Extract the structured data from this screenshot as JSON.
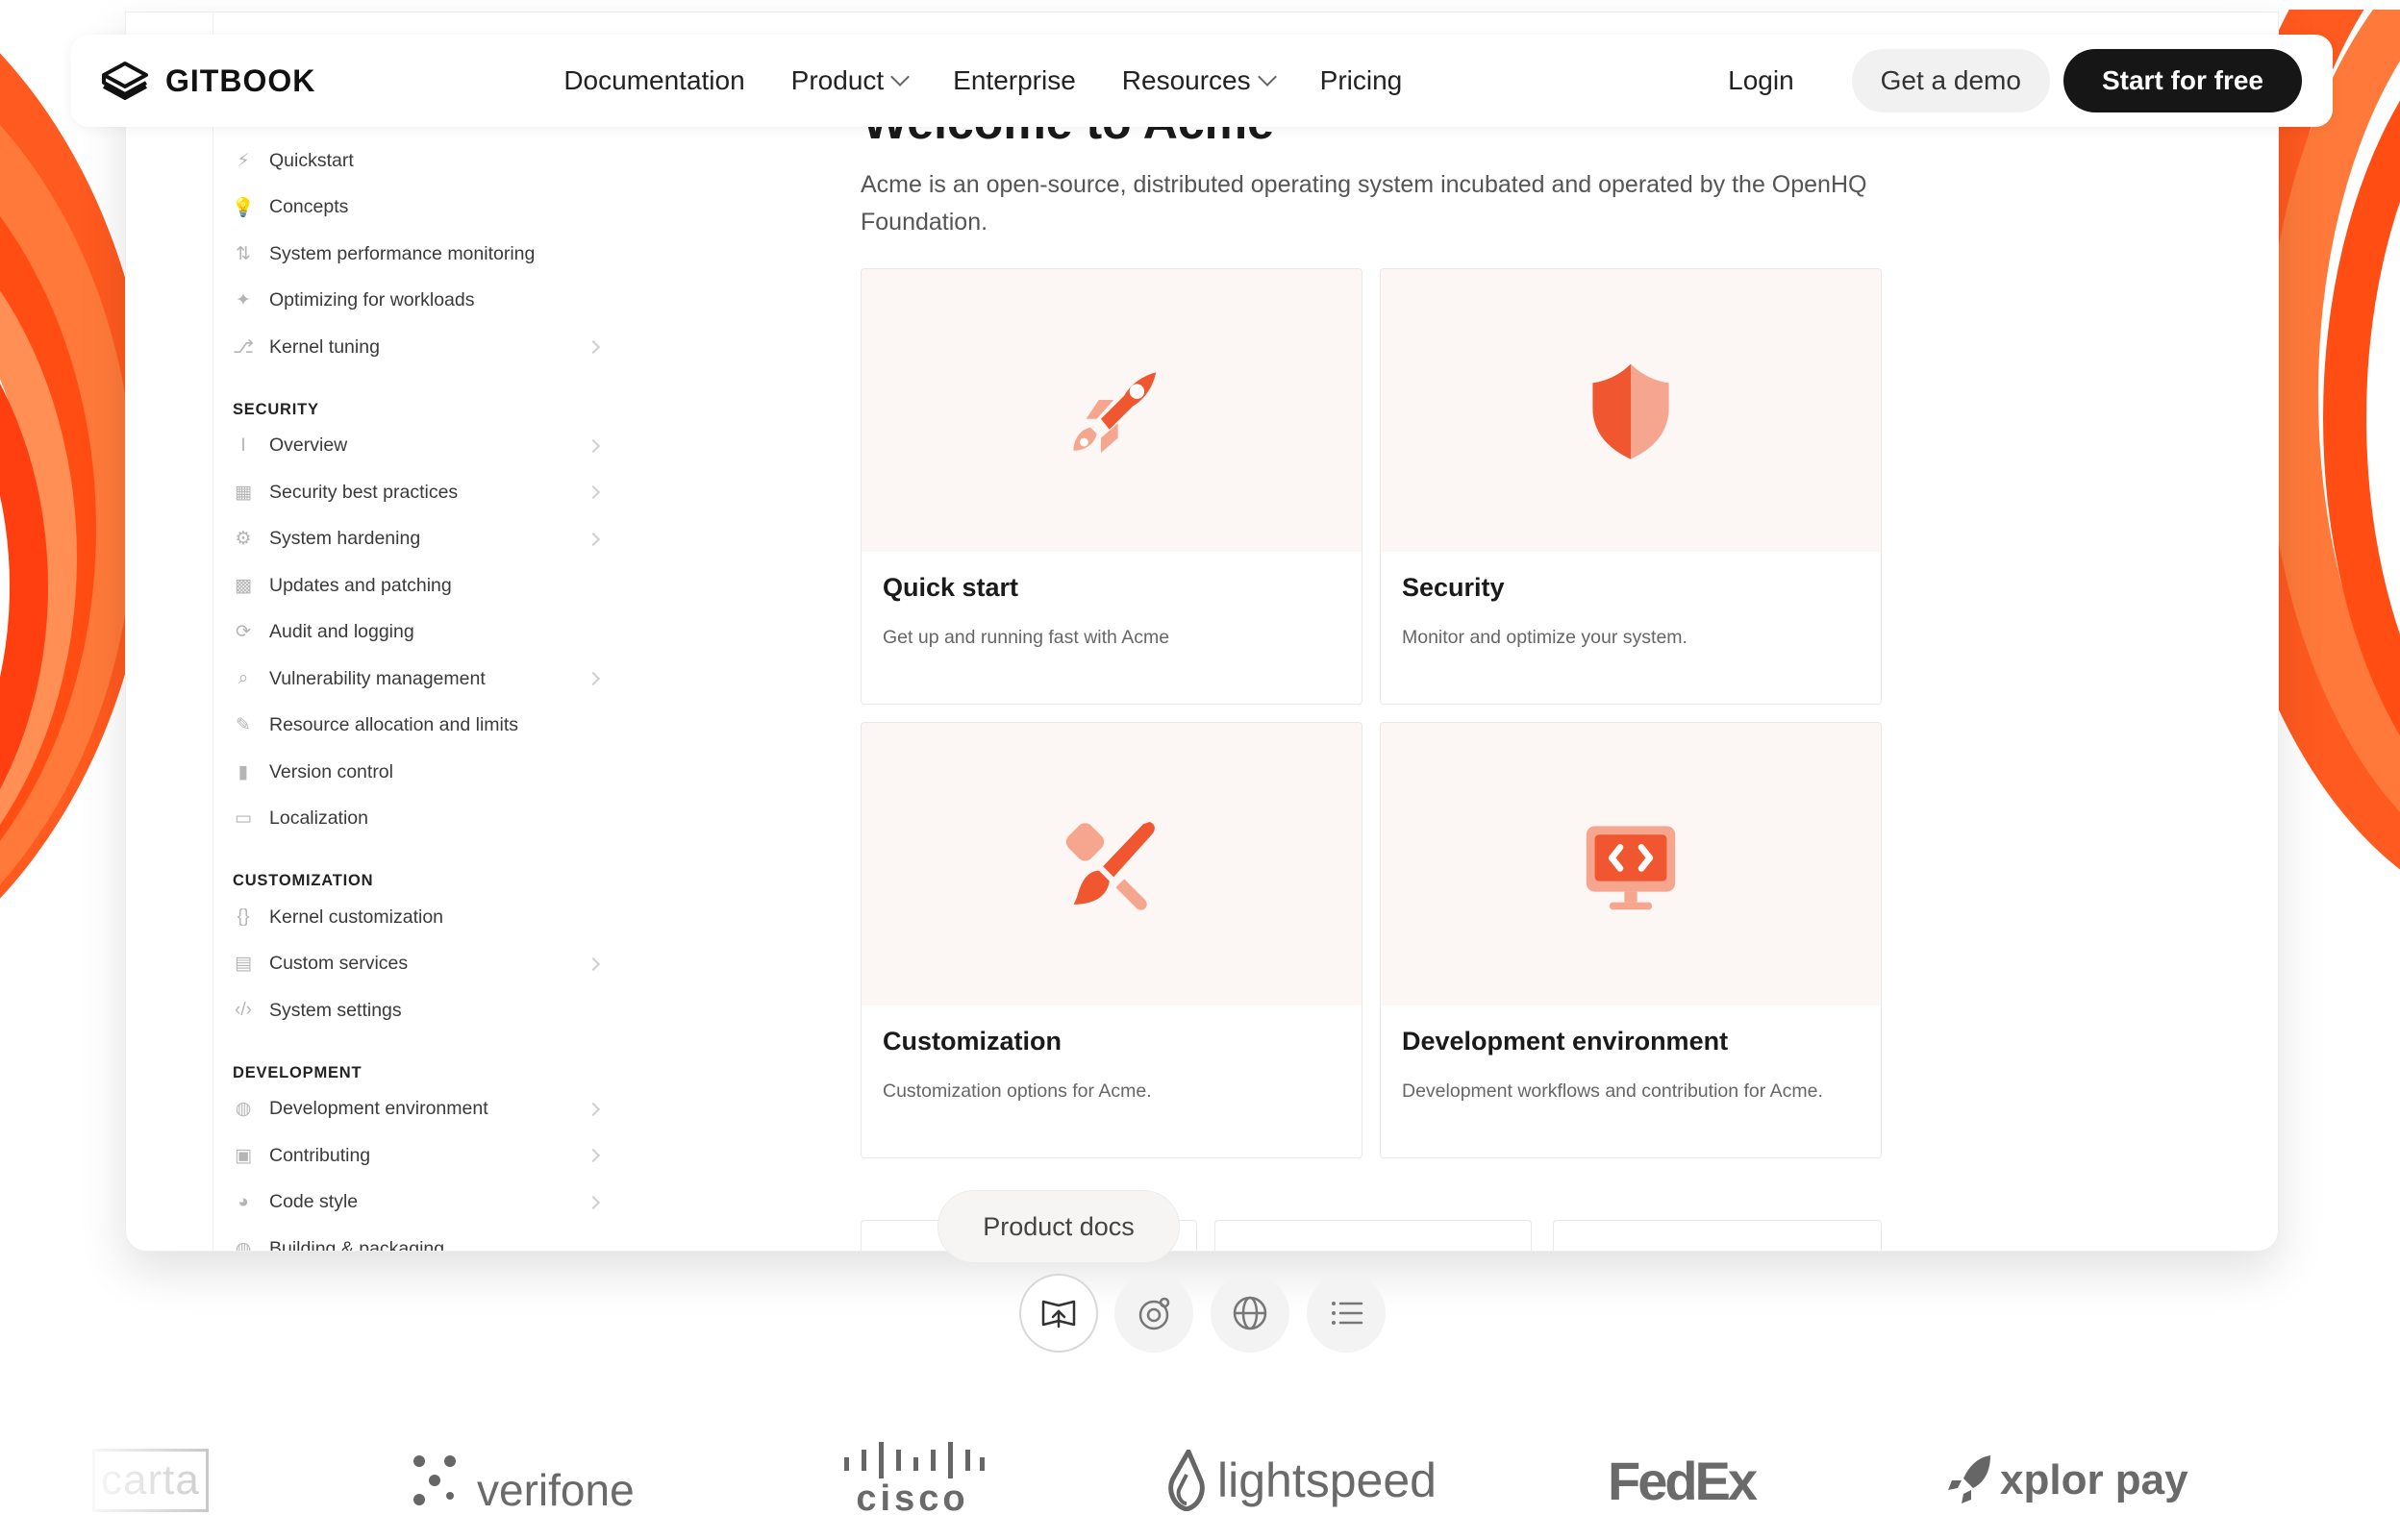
{
  "nav": {
    "brand": "GITBOOK",
    "links": [
      {
        "label": "Documentation",
        "dropdown": false
      },
      {
        "label": "Product",
        "dropdown": true
      },
      {
        "label": "Enterprise",
        "dropdown": false
      },
      {
        "label": "Resources",
        "dropdown": true
      },
      {
        "label": "Pricing",
        "dropdown": false
      }
    ],
    "login": "Login",
    "demo": "Get a demo",
    "start": "Start for free"
  },
  "sidebar": {
    "top_items": [
      {
        "label": "Quickstart",
        "icon": "bolt-icon",
        "glyph": "⚡",
        "arrow": false
      },
      {
        "label": "Concepts",
        "icon": "lightbulb-icon",
        "glyph": "💡",
        "arrow": false
      },
      {
        "label": "System performance monitoring",
        "icon": "chart-icon",
        "glyph": "⇅",
        "arrow": false
      },
      {
        "label": "Optimizing for workloads",
        "icon": "sparkle-icon",
        "glyph": "✦",
        "arrow": false
      },
      {
        "label": "Kernel tuning",
        "icon": "git-icon",
        "glyph": "⎇",
        "arrow": true
      }
    ],
    "sections": [
      {
        "title": "SECURITY",
        "items": [
          {
            "label": "Overview",
            "icon": "cursor-icon",
            "glyph": "I",
            "arrow": true
          },
          {
            "label": "Security best practices",
            "icon": "layout-icon",
            "glyph": "▦",
            "arrow": true
          },
          {
            "label": "System hardening",
            "icon": "gear-icon",
            "glyph": "⚙",
            "arrow": true
          },
          {
            "label": "Updates and patching",
            "icon": "grid-icon",
            "glyph": "▩",
            "arrow": false
          },
          {
            "label": "Audit and logging",
            "icon": "refresh-icon",
            "glyph": "⟳",
            "arrow": false
          },
          {
            "label": "Vulnerability management",
            "icon": "search-icon",
            "glyph": "⌕",
            "arrow": true
          },
          {
            "label": "Resource allocation and limits",
            "icon": "wand-icon",
            "glyph": "✎",
            "arrow": false
          },
          {
            "label": "Version control",
            "icon": "file-icon",
            "glyph": "▮",
            "arrow": false
          },
          {
            "label": "Localization",
            "icon": "translate-icon",
            "glyph": "▭",
            "arrow": false
          }
        ]
      },
      {
        "title": "CUSTOMIZATION",
        "items": [
          {
            "label": "Kernel customization",
            "icon": "braces-icon",
            "glyph": "{}",
            "arrow": false
          },
          {
            "label": "Custom services",
            "icon": "book-icon",
            "glyph": "▤",
            "arrow": true
          },
          {
            "label": "System settings",
            "icon": "code-icon",
            "glyph": "‹/›",
            "arrow": false
          }
        ]
      },
      {
        "title": "DEVELOPMENT",
        "items": [
          {
            "label": "Development environment",
            "icon": "globe-icon",
            "glyph": "◍",
            "arrow": true
          },
          {
            "label": "Contributing",
            "icon": "window-icon",
            "glyph": "▣",
            "arrow": true
          },
          {
            "label": "Code style",
            "icon": "palette-icon",
            "glyph": "◕",
            "arrow": true
          },
          {
            "label": "Building & packaging",
            "icon": "box-icon",
            "glyph": "◍",
            "arrow": false
          }
        ]
      }
    ]
  },
  "main": {
    "title": "Welcome to Acme",
    "description": "Acme is an open-source, distributed operating system incubated and operated by the OpenHQ Foundation.",
    "cards": [
      {
        "title": "Quick start",
        "desc": "Get up and running fast with Acme",
        "icon": "rocket-icon"
      },
      {
        "title": "Security",
        "desc": "Monitor and optimize your system.",
        "icon": "shield-icon"
      },
      {
        "title": "Customization",
        "desc": "Customization options for Acme.",
        "icon": "brush-icon"
      },
      {
        "title": "Development environment",
        "desc": "Development workflows and contribution for Acme.",
        "icon": "monitor-code-icon"
      }
    ]
  },
  "toolbar": {
    "pill": "Product docs",
    "buttons": [
      "book-upload-icon",
      "analytics-icon",
      "globe-icon",
      "list-icon"
    ]
  },
  "logos": [
    "carta",
    "verifone",
    "cisco",
    "lightspeed",
    "FedEx",
    "xplor pay"
  ],
  "colors": {
    "accent": "#f0562f",
    "accent_light": "#f6a58f",
    "card_bg": "#fcf6f5"
  }
}
